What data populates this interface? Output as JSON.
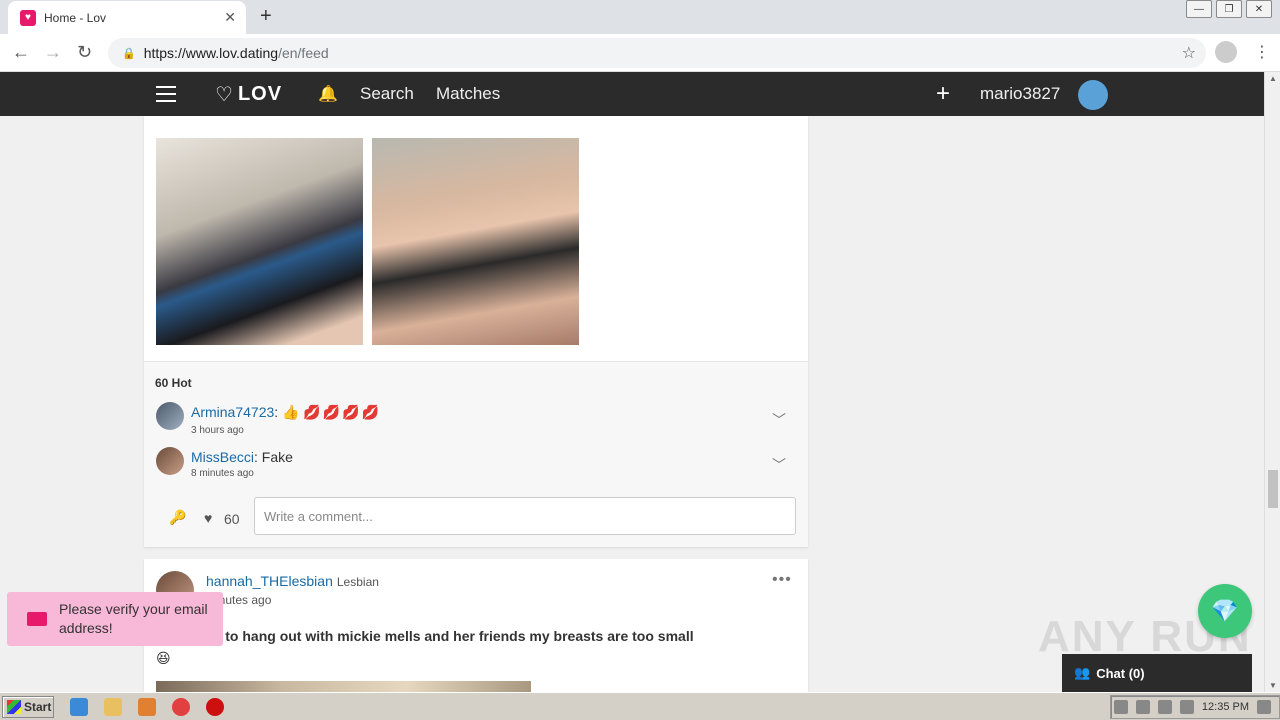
{
  "browser": {
    "tab_title": "Home - Lov",
    "tab_close": "✕",
    "new_tab": "+",
    "url_host": "https://www.lov.dating",
    "url_path": "/en/feed",
    "window_controls": [
      "—",
      "❐",
      "✕"
    ]
  },
  "app_nav": {
    "logo": "LOV",
    "search": "Search",
    "matches": "Matches",
    "add": "+",
    "username": "mario3827"
  },
  "post1": {
    "hot_label": "60 Hot",
    "comments": [
      {
        "user": "Armina74723",
        "text": "",
        "time": "3 hours ago",
        "emoji_thumb": "👍",
        "emoji_lips": "💋💋💋💋"
      },
      {
        "user": "MissBecci",
        "text": "Fake",
        "time": "8 minutes ago"
      }
    ],
    "likes": "60",
    "comment_placeholder": "Write a comment..."
  },
  "post2": {
    "user": "hannah_THElesbian",
    "tag": "Lesbian",
    "time": "minutes ago",
    "text": "er be able to hang out with mickie mells and her friends my breasts are too small",
    "emoji": "😆",
    "more": "•••"
  },
  "toast": {
    "message": "Please verify your email address!"
  },
  "chat": {
    "label": "Chat (0)"
  },
  "watermark": "ANY RUN",
  "taskbar": {
    "start": "Start",
    "clock": "12:35 PM"
  },
  "colors": {
    "brand": "#e7196a",
    "nav_bg": "#2b2b2b",
    "link": "#1a6aa5",
    "gem": "#3cc77b"
  }
}
